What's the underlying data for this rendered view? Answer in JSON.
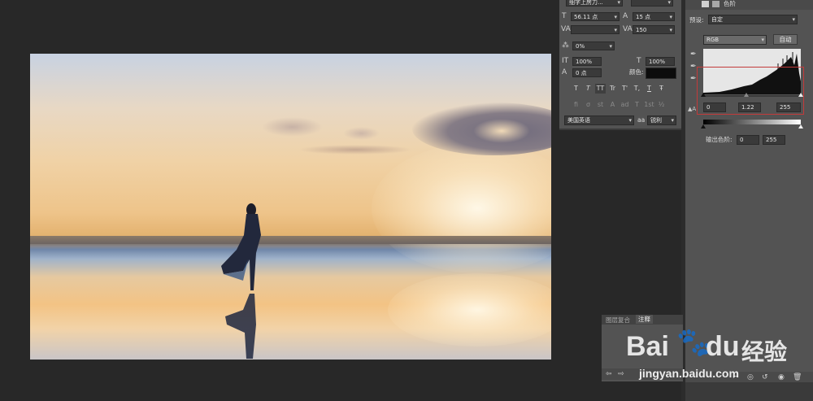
{
  "character_panel": {
    "font_style": "细字上房力...",
    "font_size": "56.11 点",
    "leading": "15 点",
    "kerning": "",
    "tracking": "150",
    "baseline_scale": "0%",
    "vertical_scale": "100%",
    "horizontal_scale": "100%",
    "baseline_shift": "0 点",
    "color_label": "颜色:",
    "typestyle_buttons": [
      "T",
      "T",
      "TT",
      "Tr",
      "T'",
      "T,",
      "T",
      "Ŧ"
    ],
    "opentype_buttons": [
      "fi",
      "σ",
      "st",
      "A",
      "ad",
      "T",
      "1st",
      "½"
    ],
    "language": "美国英语",
    "aa_label": "aa",
    "antialias": "锐利"
  },
  "levels_panel": {
    "title": "色阶",
    "preset_label": "预设:",
    "preset_value": "自定",
    "channel": "RGB",
    "auto_button": "自动",
    "input_black": "0",
    "input_gamma": "1.22",
    "input_white": "255",
    "output_label": "输出色阶:",
    "output_black": "0",
    "output_white": "255",
    "highlight_color": "#c23a3a"
  },
  "bottom_panel": {
    "tabs": [
      "图层复合",
      "注释"
    ],
    "active_tab": "注释"
  },
  "watermark": {
    "brand": "Bai",
    "brand2": "du",
    "suffix": "经验",
    "url": "jingyan.baidu.com"
  }
}
